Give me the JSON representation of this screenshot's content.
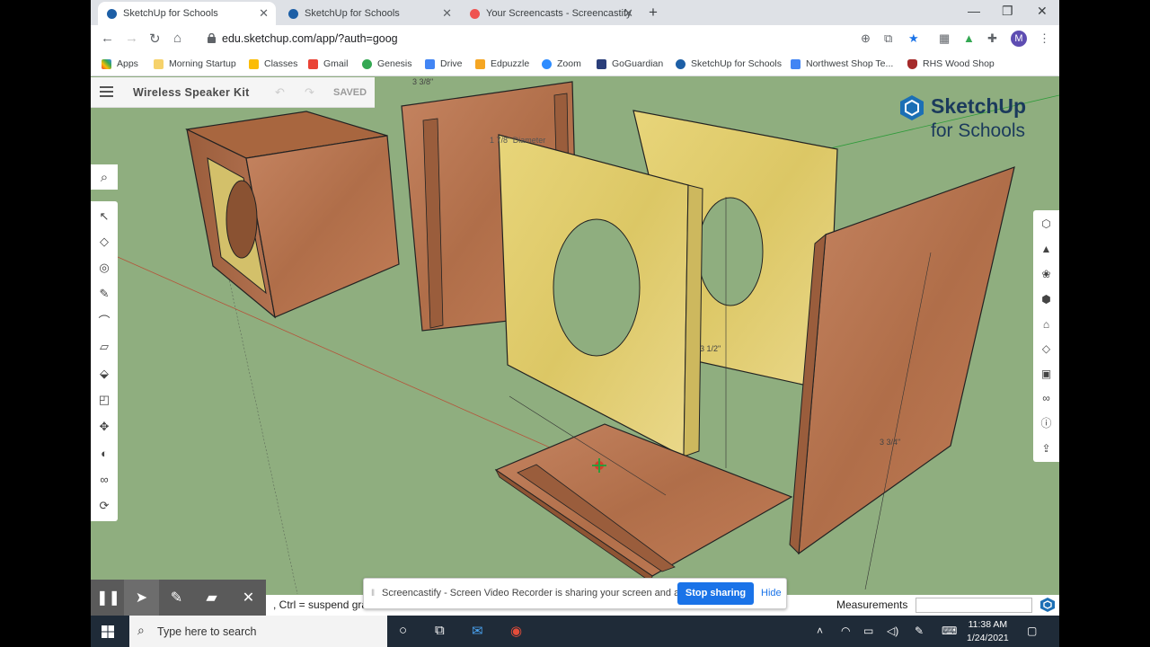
{
  "browser": {
    "tabs": [
      {
        "title": "SketchUp for Schools",
        "active": true
      },
      {
        "title": "SketchUp for Schools",
        "active": false
      },
      {
        "title": "Your Screencasts - Screencastify",
        "active": false
      }
    ],
    "url": "edu.sketchup.com/app/?auth=goog",
    "profile_initial": "M",
    "bookmarks": [
      "Apps",
      "Morning Startup",
      "Classes",
      "Gmail",
      "Genesis",
      "Drive",
      "Edpuzzle",
      "Zoom",
      "GoGuardian",
      "SketchUp for Schools",
      "Northwest Shop Te...",
      "RHS Wood Shop"
    ]
  },
  "sketchup": {
    "title": "Wireless Speaker Kit",
    "saved_label": "SAVED",
    "logo_line1": "SketchUp",
    "logo_line2": "for Schools",
    "status_hint": ", Ctrl = suspend gra",
    "measurements_label": "Measurements",
    "dimensions": [
      "3 3/8\"",
      "1 7/8\" Diameter",
      "3 1/2\"",
      "3 3/4\""
    ],
    "left_tools": [
      "select-icon",
      "eraser-icon",
      "paint-bucket-icon",
      "pencil-line-icon",
      "arc-icon",
      "rectangle-icon",
      "push-pull-icon",
      "offset-icon",
      "move-icon",
      "tape-measure-icon",
      "orbit-footprints-icon",
      "orbit-icon"
    ],
    "right_tools": [
      "entity-info-icon",
      "instructor-icon",
      "components-icon",
      "materials-icon",
      "outliner-icon",
      "tags-icon",
      "scenes-icon",
      "display-icon",
      "info-icon",
      "export-icon"
    ]
  },
  "screencastify": {
    "share_text": "Screencastify - Screen Video Recorder is sharing your screen and audio.",
    "stop_label": "Stop sharing",
    "hide_label": "Hide"
  },
  "taskbar": {
    "search_placeholder": "Type here to search",
    "time": "11:38 AM",
    "date": "1/24/2021"
  },
  "colors": {
    "ground": "#8fae7f",
    "wood": "#b97450",
    "foam": "#e6d27a",
    "accent": "#1a73e8"
  }
}
